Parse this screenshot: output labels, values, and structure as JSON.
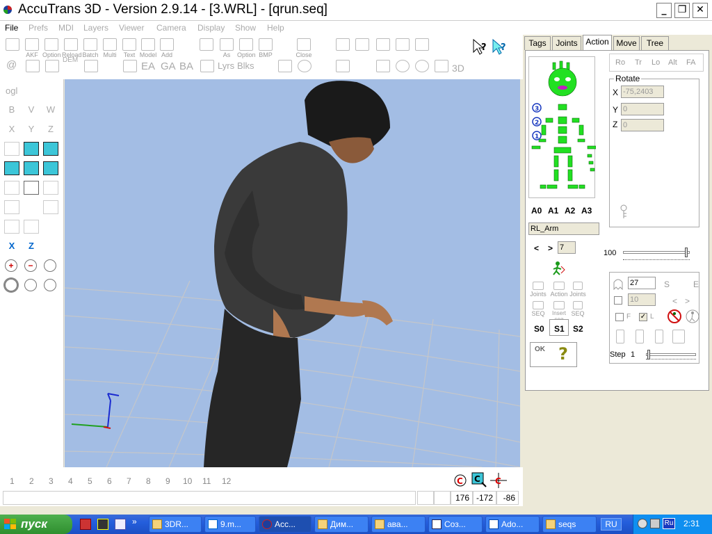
{
  "window": {
    "title": "AccuTrans 3D - Version 2.9.14 - [3.WRL] - [qrun.seq]",
    "min_glyph": "_",
    "max_glyph": "❐",
    "close_glyph": "✕"
  },
  "menu": [
    "File",
    "Prefs",
    "MDI",
    "Layers",
    "Viewer",
    "Camera",
    "Display",
    "Show",
    "Help"
  ],
  "toolbar": {
    "row1": [
      {
        "label": "",
        "icon": "open-folder-icon"
      },
      {
        "label": "AKF",
        "icon": "open-akf-icon"
      },
      {
        "label": "Option",
        "icon": "open-option-icon"
      },
      {
        "label": "Reload",
        "icon": "reload-icon"
      },
      {
        "label": "Batch",
        "icon": "batch-icon"
      },
      {
        "label": "Multi",
        "icon": "multi-icon"
      },
      {
        "label": "Text",
        "icon": "text-icon"
      },
      {
        "label": "Model",
        "icon": "model-icon"
      },
      {
        "label": "Add",
        "icon": "add-icon"
      },
      {
        "label": "",
        "icon": "save-icon"
      },
      {
        "label": "As",
        "icon": "save-as-icon"
      },
      {
        "label": "Option",
        "icon": "save-option-icon"
      },
      {
        "label": "BMP",
        "icon": "save-bmp-icon"
      },
      {
        "label": "Close",
        "icon": "close-file-icon"
      }
    ],
    "row2_text": [
      "@",
      "DEM",
      "EA",
      "GA",
      "BA",
      "Lyrs",
      "Blks",
      "3D"
    ],
    "help_icons": [
      "help-cursor-icon",
      "context-help-icon"
    ]
  },
  "left_tools": {
    "ogl_label": "ogl",
    "rotate": [
      "B",
      "V",
      "W",
      "X",
      "Y",
      "Z"
    ],
    "axis_x": "X",
    "axis_z": "Z"
  },
  "frames": [
    "1",
    "2",
    "3",
    "4",
    "5",
    "6",
    "7",
    "8",
    "9",
    "10",
    "11",
    "12"
  ],
  "status": {
    "x": "176",
    "y": "-172",
    "z": "-86"
  },
  "tabs": [
    "Tags",
    "Joints",
    "Action",
    "Move",
    "Tree"
  ],
  "active_tab": "Action",
  "action": {
    "levels": [
      "3",
      "2",
      "1"
    ],
    "anims": [
      "A0",
      "A1",
      "A2",
      "A3"
    ],
    "joint_name": "RL_Arm",
    "nav_prev": "<",
    "nav_next": ">",
    "frame_value": "7",
    "small_buttons": [
      "Joints",
      "Action",
      "Joints",
      "SEQ",
      "Insert seq",
      "SEQ"
    ],
    "seq_buttons": [
      "S0",
      "S1",
      "S2"
    ],
    "ok_label": "OK",
    "help_label": "?",
    "mode_buttons": [
      "Ro",
      "Tr",
      "Lo",
      "Alt",
      "FA"
    ],
    "rotate_title": "Rotate",
    "rot_x_label": "X",
    "rot_x": "-75,2403",
    "rot_y_label": "Y",
    "rot_y": "0",
    "rot_z_label": "Z",
    "rot_z": "0",
    "slider_label": "100",
    "slider_value": 0.98,
    "count1": "27",
    "count2": "10",
    "s_label": "S",
    "e_label": "E",
    "f_label": "F",
    "l_label": "L",
    "step_label": "Step",
    "step_value": "1",
    "step_slider": 0.02
  },
  "taskbar": {
    "start": "пуск",
    "tasks": [
      {
        "label": "3DR...",
        "active": false
      },
      {
        "label": "9.m...",
        "active": false
      },
      {
        "label": "Acc...",
        "active": true
      },
      {
        "label": "Дим...",
        "active": false
      },
      {
        "label": "ава...",
        "active": false
      },
      {
        "label": "Соз...",
        "active": false
      },
      {
        "label": "Ado...",
        "active": false
      },
      {
        "label": "seqs",
        "active": false
      }
    ],
    "lang": "RU",
    "tray_lang": "Ru",
    "clock": "2:31"
  },
  "colors": {
    "viewport_bg": "#a3bde4",
    "skeleton_green": "#22e022",
    "cube_cyan": "#3cc6d8",
    "taskbar_blue": "#245edc",
    "start_green": "#3c9c3c"
  }
}
